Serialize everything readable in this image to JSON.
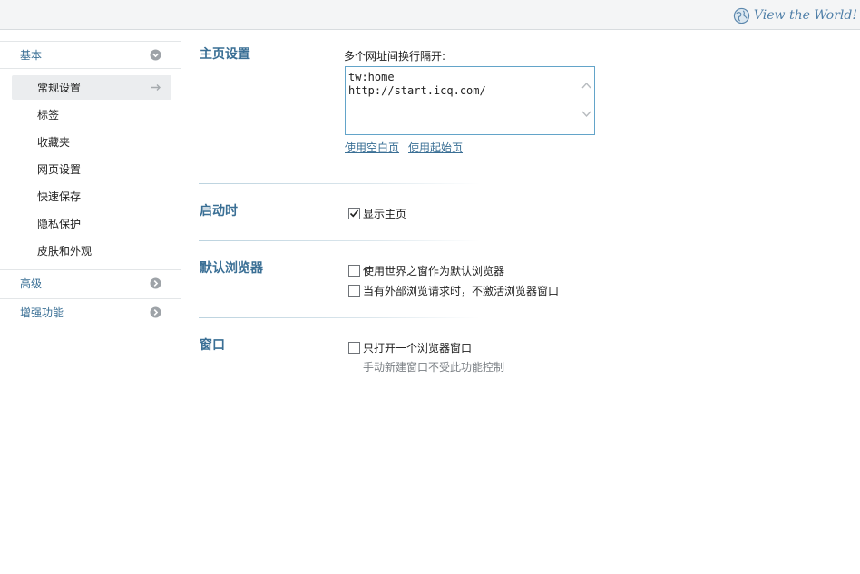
{
  "brand": {
    "text": "View the World!",
    "icon": "globe-icon"
  },
  "sidebar": {
    "sections": [
      {
        "label": "基本",
        "icon": "chevron-down-icon",
        "expanded": true
      },
      {
        "label": "高级",
        "icon": "chevron-right-icon",
        "expanded": false
      },
      {
        "label": "增强功能",
        "icon": "chevron-right-icon",
        "expanded": false
      }
    ],
    "items": [
      {
        "label": "常规设置",
        "active": true
      },
      {
        "label": "标签"
      },
      {
        "label": "收藏夹"
      },
      {
        "label": "网页设置"
      },
      {
        "label": "快速保存"
      },
      {
        "label": "隐私保护"
      },
      {
        "label": "皮肤和外观"
      }
    ]
  },
  "homepage": {
    "title": "主页设置",
    "prompt": "多个网址间换行隔开:",
    "urls": [
      "tw:home",
      "http://start.icq.com/"
    ],
    "use_blank": "使用空白页",
    "use_start": "使用起始页"
  },
  "startup": {
    "title": "启动时",
    "show_home_label": "显示主页",
    "show_home_checked": true
  },
  "default_browser": {
    "title": "默认浏览器",
    "set_default_label": "使用世界之窗作为默认浏览器",
    "set_default_checked": false,
    "no_activate_label": "当有外部浏览请求时，不激活浏览器窗口",
    "no_activate_checked": false
  },
  "window": {
    "title": "窗口",
    "single_window_label": "只打开一个浏览器窗口",
    "single_window_checked": false,
    "hint": "手动新建窗口不受此功能控制"
  },
  "colors": {
    "accent": "#3a6f95",
    "border_focus": "#63a4c9"
  }
}
